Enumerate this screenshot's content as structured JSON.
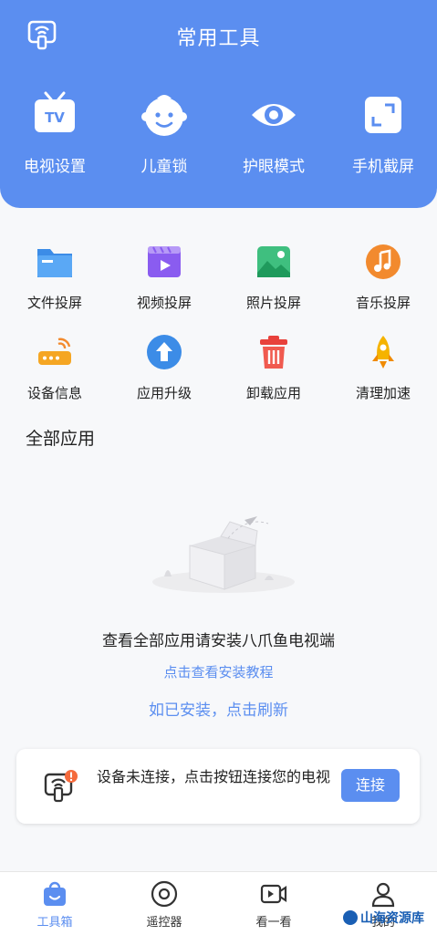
{
  "header": {
    "title": "常用工具",
    "quick_actions": [
      {
        "label": "电视设置",
        "icon": "tv-icon"
      },
      {
        "label": "儿童锁",
        "icon": "child-face-icon"
      },
      {
        "label": "护眼模式",
        "icon": "eye-icon"
      },
      {
        "label": "手机截屏",
        "icon": "screenshot-icon"
      }
    ]
  },
  "tools": [
    {
      "label": "文件投屏",
      "icon": "folder-icon"
    },
    {
      "label": "视频投屏",
      "icon": "video-icon"
    },
    {
      "label": "照片投屏",
      "icon": "photo-icon"
    },
    {
      "label": "音乐投屏",
      "icon": "music-icon"
    },
    {
      "label": "设备信息",
      "icon": "router-icon"
    },
    {
      "label": "应用升级",
      "icon": "upgrade-icon"
    },
    {
      "label": "卸载应用",
      "icon": "trash-icon"
    },
    {
      "label": "清理加速",
      "icon": "rocket-icon"
    }
  ],
  "apps_section": {
    "title": "全部应用",
    "empty_text": "查看全部应用请安装八爪鱼电视端",
    "install_link": "点击查看安装教程",
    "refresh_link": "如已安装，点击刷新"
  },
  "connection": {
    "message": "设备未连接，点击按钮连接您的电视",
    "button_label": "连接"
  },
  "bottom_nav": [
    {
      "label": "工具箱",
      "icon": "toolbox-icon",
      "active": true
    },
    {
      "label": "遥控器",
      "icon": "remote-icon",
      "active": false
    },
    {
      "label": "看一看",
      "icon": "watch-icon",
      "active": false
    },
    {
      "label": "我的",
      "icon": "profile-icon",
      "active": false
    }
  ],
  "watermark": "山海资源库",
  "colors": {
    "accent": "#5b8ef0",
    "background": "#f7f8fa"
  }
}
